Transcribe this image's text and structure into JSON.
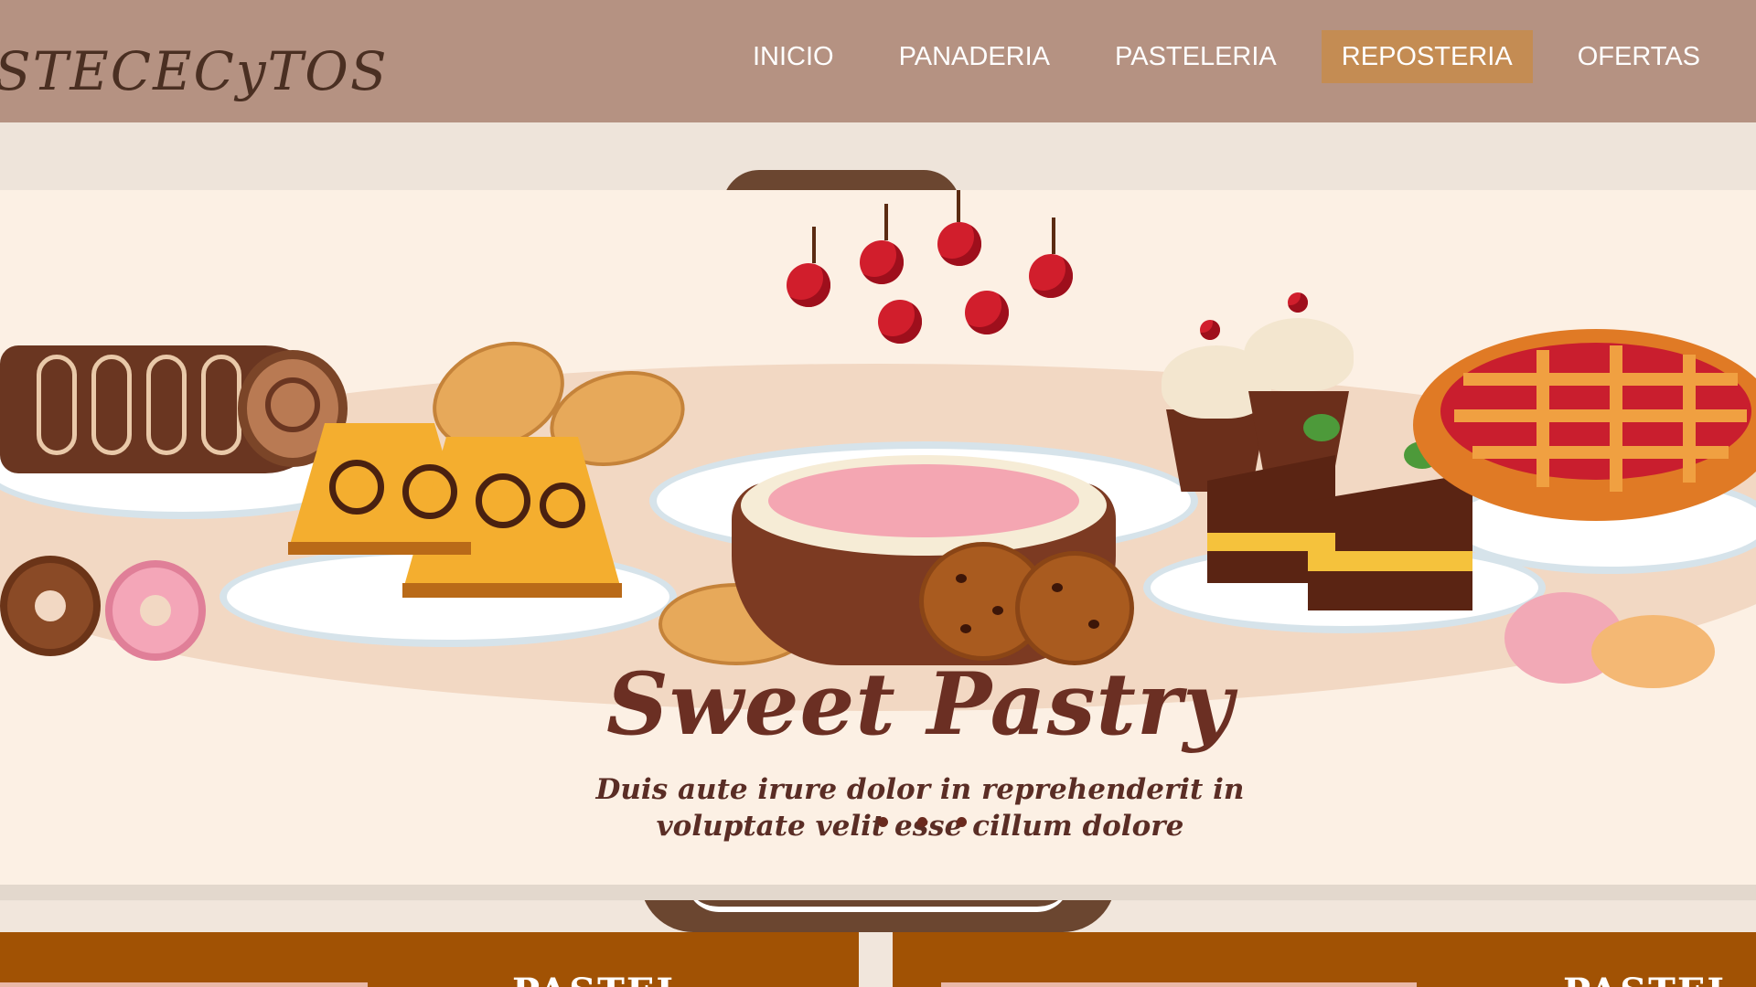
{
  "header": {
    "logo": "STECECyTOS",
    "nav": [
      {
        "label": "INICIO",
        "active": false
      },
      {
        "label": "PANADERIA",
        "active": false
      },
      {
        "label": "PASTELERIA",
        "active": false
      },
      {
        "label": "REPOSTERIA",
        "active": true
      },
      {
        "label": "OFERTAS",
        "active": false
      }
    ]
  },
  "hero": {
    "title": "Sweet Pastry",
    "subtitle_line1": "Duis aute irure dolor in reprehenderit in",
    "subtitle_line2": "voluptate velit esse cillum dolore",
    "slide_count": 3
  },
  "cards": [
    {
      "title": "PASTEL"
    },
    {
      "title": "PASTEL"
    }
  ],
  "colors": {
    "header_bg": "#b59282",
    "nav_active_bg": "#c48c53",
    "card_bg": "#a15204",
    "title_color": "#6b2f23"
  }
}
